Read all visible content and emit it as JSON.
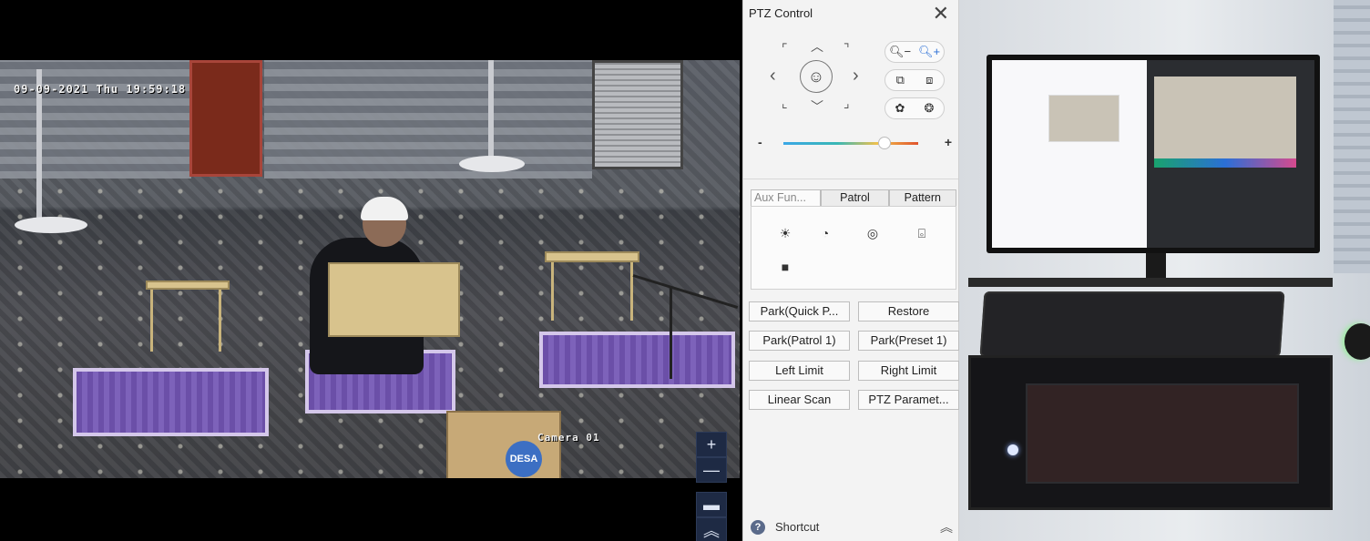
{
  "camera": {
    "timestamp": "09-09-2021 Thu 19:59:18",
    "name": "Camera 01",
    "box_brand": "DESA",
    "zoom_in_label": "+",
    "zoom_out_label": "—"
  },
  "ptz": {
    "title": "PTZ Control",
    "close_glyph": "✕",
    "dpad": {
      "up": "︿",
      "down": "﹀",
      "left": "‹",
      "right": "›",
      "up_left": "⌜",
      "up_right": "⌝",
      "down_left": "⌞",
      "down_right": "⌟",
      "center": "☺"
    },
    "speed": {
      "minus": "-",
      "plus": "+",
      "level": 0.75
    },
    "tabs": [
      {
        "label": "Aux Fun...",
        "active": true
      },
      {
        "label": "Patrol",
        "active": false
      },
      {
        "label": "Pattern",
        "active": false
      }
    ],
    "aux_icons": [
      "light-icon",
      "wiper-icon",
      "one-touch-focus-icon",
      "lens-init-icon",
      "manual-track-icon"
    ],
    "buttons": [
      "Park(Quick P...",
      "Restore",
      "Park(Patrol 1)",
      "Park(Preset 1)",
      "Left Limit",
      "Right Limit",
      "Linear Scan",
      "PTZ Paramet..."
    ],
    "shortcut": {
      "label": "Shortcut",
      "icon_glyph": "?",
      "collapse_glyph": "︽"
    }
  },
  "colors": {
    "panel_bg": "#f3f3f3",
    "accent_blue": "#2b6fd6",
    "zoom_button_bg": "#1e2a44"
  }
}
